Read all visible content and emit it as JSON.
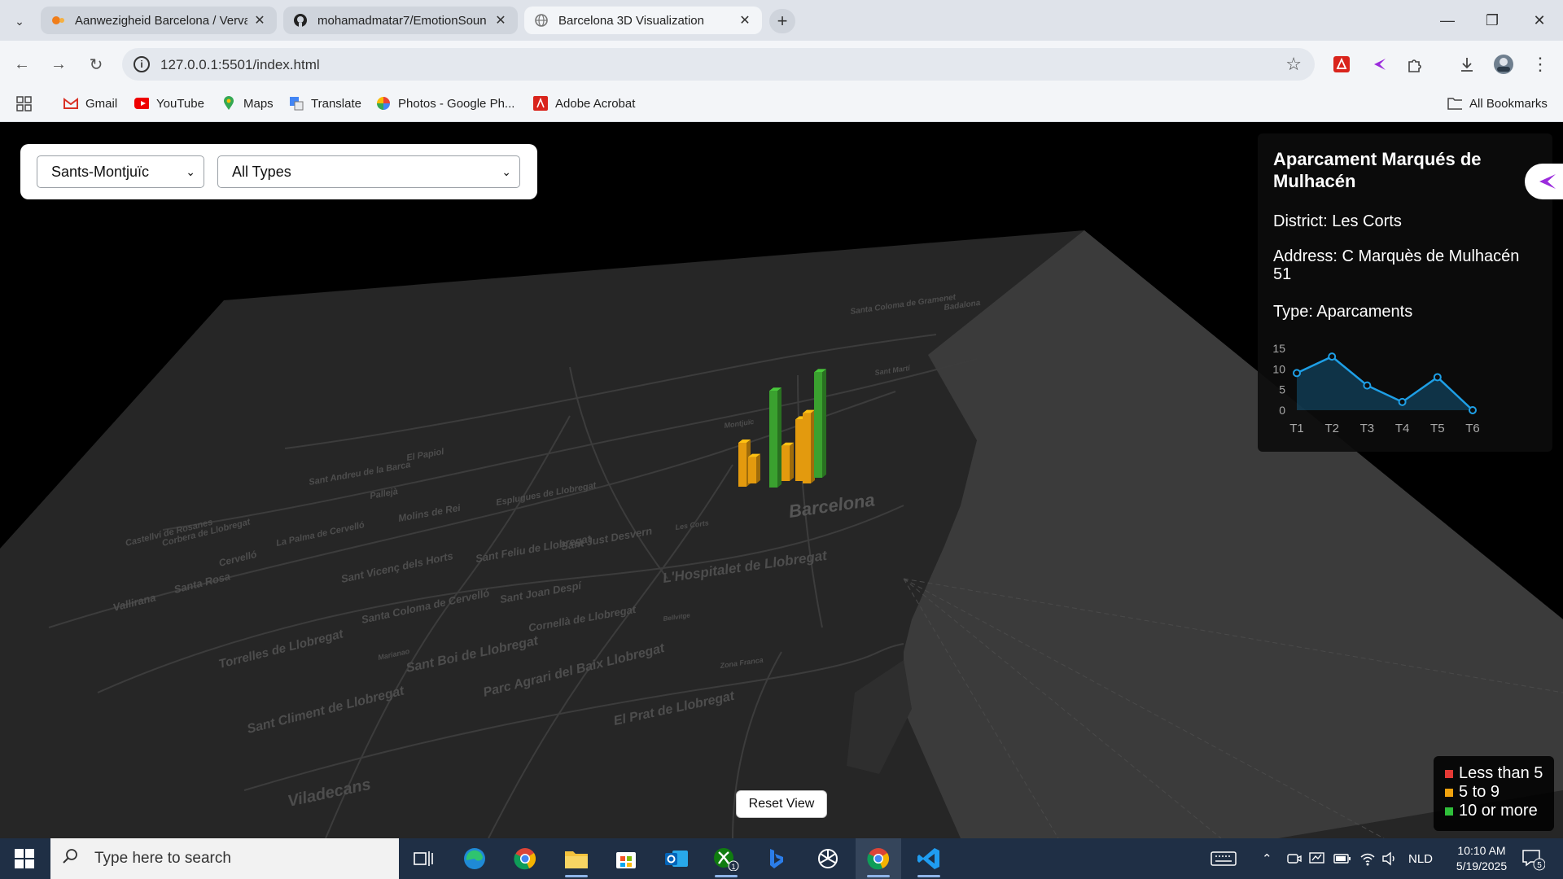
{
  "browser": {
    "tabs": [
      {
        "title": "Aanwezigheid Barcelona / Verva",
        "state": "inactive"
      },
      {
        "title": "mohamadmatar7/EmotionSoun",
        "state": "inactive"
      },
      {
        "title": "Barcelona 3D Visualization",
        "state": "active"
      }
    ],
    "url": "127.0.0.1:5501/index.html",
    "bookmarks": [
      "Gmail",
      "YouTube",
      "Maps",
      "Translate",
      "Photos - Google Ph...",
      "Adobe Acrobat"
    ],
    "all_bookmarks": "All Bookmarks"
  },
  "page": {
    "filters": {
      "district_selected": "Sants-Montjuïc",
      "type_selected": "All Types"
    },
    "map_labels": [
      "Barcelona",
      "Sant Feliu de Llobregat",
      "Sant Just Desvern",
      "L'Hospitalet de Llobregat",
      "Sant Joan Despí",
      "Cornellà de Llobregat",
      "Esplugues de Llobregat",
      "Santa Coloma de Cervelló",
      "Sant Vicenç dels Horts",
      "Torrelles de Llobregat",
      "Sant Boi de Llobregat",
      "Parc Agrari del Baix Llobregat",
      "Sant Climent de Llobregat",
      "El Prat de Llobregat",
      "Viladecans",
      "Molins de Rei",
      "Vallirana",
      "Cervelló",
      "Santa Rosa",
      "La Palma de Cervelló",
      "Corbera de Llobregat",
      "Castellví de Rosanes",
      "Sant Andreu de la Barca",
      "El Papiol",
      "Pallejà",
      "Santa Coloma de Gramenet",
      "Badalona",
      "Sant Martí",
      "Les Corts",
      "Zona Franca",
      "Bellvitge",
      "Marianao",
      "Montjuïc"
    ],
    "bars": [
      {
        "height": 5,
        "color": "#e39a0e"
      },
      {
        "height": 3,
        "color": "#e39a0e"
      },
      {
        "height": 11,
        "color": "#3aa12f"
      },
      {
        "height": 4,
        "color": "#e39a0e"
      },
      {
        "height": 7,
        "color": "#e39a0e"
      },
      {
        "height": 8,
        "color": "#e39a0e"
      },
      {
        "height": 12,
        "color": "#3aa12f"
      }
    ],
    "info": {
      "name": "Aparcament Marqués de Mulhacén",
      "district_label": "District:",
      "district": "Les Corts",
      "address_label": "Address:",
      "address": "C Marquès de Mulhacén 51",
      "type_label": "Type:",
      "type": "Aparcaments",
      "mini_chart": {
        "type": "area",
        "x": [
          "T1",
          "T2",
          "T3",
          "T4",
          "T5",
          "T6"
        ],
        "values": [
          9,
          13,
          6,
          2,
          8,
          0
        ],
        "ylim": [
          0,
          15
        ],
        "yticks": [
          0,
          5,
          10,
          15
        ],
        "color": "#1e9fe6"
      }
    },
    "reset_label": "Reset View",
    "legend": [
      {
        "label": "Less than 5",
        "color": "#e53935"
      },
      {
        "label": "5 to 9",
        "color": "#f0a20e"
      },
      {
        "label": "10 or more",
        "color": "#2fbf3a"
      }
    ]
  },
  "taskbar": {
    "search_placeholder": "Type here to search",
    "language": "NLD",
    "time": "10:10 AM",
    "date": "5/19/2025",
    "notification_count": "5",
    "xbox_badge": "1"
  }
}
